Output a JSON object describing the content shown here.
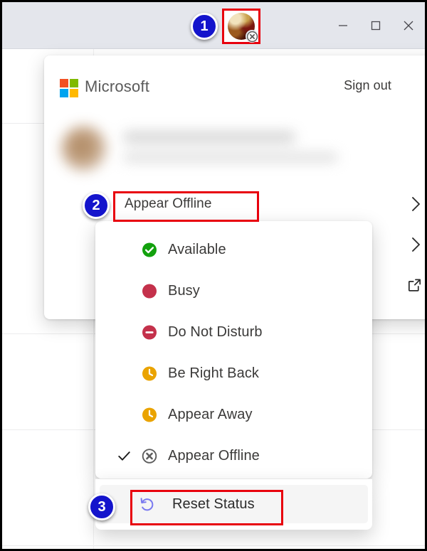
{
  "window": {
    "controls": [
      {
        "name": "minimize",
        "glyph": "minimize-icon",
        "label": "Minimize"
      },
      {
        "name": "maximize",
        "glyph": "maximize-icon",
        "label": "Maximize"
      },
      {
        "name": "close",
        "glyph": "close-icon",
        "label": "Close"
      }
    ],
    "titlebar_color": "#e4e6ec"
  },
  "avatar": {
    "name": "account-avatar",
    "status_badge_icon": "offline-x-circle-icon",
    "status_badge_color": "#5d5d5d"
  },
  "steps": [
    {
      "number": "1",
      "target": "account-avatar"
    },
    {
      "number": "2",
      "target": "status-row"
    },
    {
      "number": "3",
      "target": "reset-status-row"
    }
  ],
  "account_panel": {
    "brand": "Microsoft",
    "sign_out_label": "Sign out",
    "logo_colors": {
      "top_left": "#f25022",
      "top_right": "#7fba00",
      "bottom_left": "#00a4ef",
      "bottom_right": "#ffb900"
    },
    "identity": {
      "blurred": true,
      "name_redacted": "",
      "email_redacted": ""
    },
    "rows": [
      {
        "label": "Appear Offline",
        "affordance": "chevron-right-icon"
      },
      {
        "label": "",
        "affordance": "chevron-right-icon"
      },
      {
        "label": "",
        "affordance": "external-link-icon"
      }
    ]
  },
  "status_menu": {
    "items": [
      {
        "label": "Available",
        "icon": "available-check-circle-icon",
        "color": "#13a10e",
        "checked": false
      },
      {
        "label": "Busy",
        "icon": "busy-filled-circle-icon",
        "color": "#c4314b",
        "checked": false
      },
      {
        "label": "Do Not Disturb",
        "icon": "dnd-minus-circle-icon",
        "color": "#c4314b",
        "checked": false
      },
      {
        "label": "Be Right Back",
        "icon": "away-clock-icon",
        "color": "#eaa300",
        "checked": false
      },
      {
        "label": "Appear Away",
        "icon": "away-clock-icon",
        "color": "#eaa300",
        "checked": false
      },
      {
        "label": "Appear Offline",
        "icon": "offline-x-circle-icon",
        "color": "#5d5d5d",
        "checked": true
      }
    ],
    "check_glyph": "checkmark-icon"
  },
  "reset": {
    "label": "Reset Status",
    "icon": "reset-undo-arrow-icon",
    "icon_color": "#7a7af0"
  },
  "accents": {
    "highlight_box": "#e8000d",
    "step_badge": "#1414cc"
  }
}
